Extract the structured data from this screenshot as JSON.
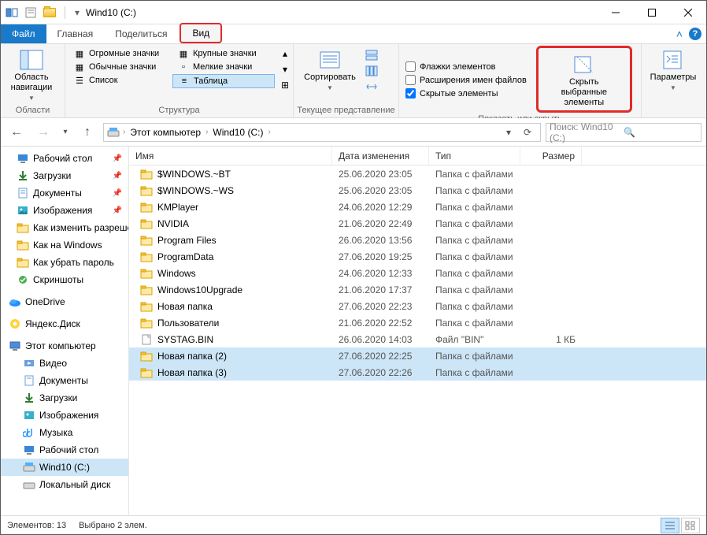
{
  "title": "Wind10 (C:)",
  "tabs": {
    "file": "Файл",
    "home": "Главная",
    "share": "Поделиться",
    "view": "Вид"
  },
  "ribbon": {
    "panes": {
      "nav_area": "Область навигации",
      "label": "Области"
    },
    "layout": {
      "huge": "Огромные значки",
      "large": "Крупные значки",
      "normal": "Обычные значки",
      "small": "Мелкие значки",
      "list": "Список",
      "table": "Таблица",
      "label": "Структура"
    },
    "sort": {
      "sort": "Сортировать",
      "label": "Текущее представление"
    },
    "show": {
      "checkboxes": "Флажки элементов",
      "extensions": "Расширения имен файлов",
      "hidden": "Скрытые элементы",
      "hide_selected": "Скрыть выбранные элементы",
      "label": "Показать или скрыть"
    },
    "options": "Параметры"
  },
  "breadcrumb": {
    "pc": "Этот компьютер",
    "drive": "Wind10 (C:)"
  },
  "search_placeholder": "Поиск: Wind10 (C:)",
  "sidebar": {
    "quick": [
      {
        "label": "Рабочий стол",
        "pin": true
      },
      {
        "label": "Загрузки",
        "pin": true
      },
      {
        "label": "Документы",
        "pin": true
      },
      {
        "label": "Изображения",
        "pin": true
      },
      {
        "label": "Как изменить разрешение",
        "pin": true
      },
      {
        "label": "Как на Windows",
        "pin": false
      },
      {
        "label": "Как убрать пароль",
        "pin": false
      },
      {
        "label": "Скриншоты",
        "pin": false
      }
    ],
    "onedrive": "OneDrive",
    "yadisk": "Яндекс.Диск",
    "thispc": "Этот компьютер",
    "pc_children": [
      "Видео",
      "Документы",
      "Загрузки",
      "Изображения",
      "Музыка",
      "Рабочий стол"
    ],
    "drive": "Wind10 (C:)",
    "localdisk": "Локальный диск"
  },
  "columns": {
    "name": "Имя",
    "date": "Дата изменения",
    "type": "Тип",
    "size": "Размер"
  },
  "files": [
    {
      "name": "$WINDOWS.~BT",
      "date": "25.06.2020 23:05",
      "type": "Папка с файлами",
      "size": "",
      "kind": "folder",
      "sel": false
    },
    {
      "name": "$WINDOWS.~WS",
      "date": "25.06.2020 23:05",
      "type": "Папка с файлами",
      "size": "",
      "kind": "folder",
      "sel": false
    },
    {
      "name": "KMPlayer",
      "date": "24.06.2020 12:29",
      "type": "Папка с файлами",
      "size": "",
      "kind": "folder",
      "sel": false
    },
    {
      "name": "NVIDIA",
      "date": "21.06.2020 22:49",
      "type": "Папка с файлами",
      "size": "",
      "kind": "folder",
      "sel": false
    },
    {
      "name": "Program Files",
      "date": "26.06.2020 13:56",
      "type": "Папка с файлами",
      "size": "",
      "kind": "folder",
      "sel": false
    },
    {
      "name": "ProgramData",
      "date": "27.06.2020 19:25",
      "type": "Папка с файлами",
      "size": "",
      "kind": "folder",
      "sel": false
    },
    {
      "name": "Windows",
      "date": "24.06.2020 12:33",
      "type": "Папка с файлами",
      "size": "",
      "kind": "folder",
      "sel": false
    },
    {
      "name": "Windows10Upgrade",
      "date": "21.06.2020 17:37",
      "type": "Папка с файлами",
      "size": "",
      "kind": "folder",
      "sel": false
    },
    {
      "name": "Новая папка",
      "date": "27.06.2020 22:23",
      "type": "Папка с файлами",
      "size": "",
      "kind": "folder",
      "sel": false
    },
    {
      "name": "Пользователи",
      "date": "21.06.2020 22:52",
      "type": "Папка с файлами",
      "size": "",
      "kind": "folder",
      "sel": false
    },
    {
      "name": "SYSTAG.BIN",
      "date": "26.06.2020 14:03",
      "type": "Файл \"BIN\"",
      "size": "1 КБ",
      "kind": "file",
      "sel": false
    },
    {
      "name": "Новая папка (2)",
      "date": "27.06.2020 22:25",
      "type": "Папка с файлами",
      "size": "",
      "kind": "folder",
      "sel": true
    },
    {
      "name": "Новая папка (3)",
      "date": "27.06.2020 22:26",
      "type": "Папка с файлами",
      "size": "",
      "kind": "folder",
      "sel": true
    }
  ],
  "status": {
    "count": "Элементов: 13",
    "selected": "Выбрано 2 элем."
  }
}
